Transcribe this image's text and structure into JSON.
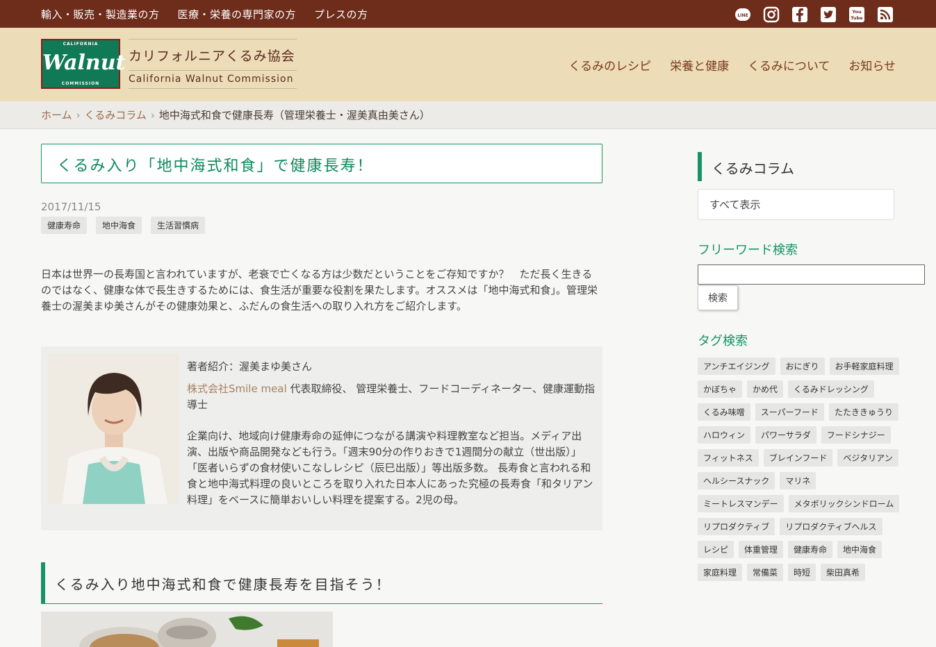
{
  "topbar": {
    "links": [
      "輸入・販売・製造業の方",
      "医療・栄養の専門家の方",
      "プレスの方"
    ],
    "social_icons": [
      "line-icon",
      "instagram-icon",
      "facebook-icon",
      "twitter-icon",
      "youtube-icon",
      "rss-icon"
    ]
  },
  "logo": {
    "top_text": "CALIFORNIA",
    "main_text": "Walnut",
    "bottom_text": "COMMISSION",
    "org_jp": "カリフォルニアくるみ協会",
    "org_en": "California Walnut Commission"
  },
  "nav": {
    "items": [
      "くるみのレシピ",
      "栄養と健康",
      "くるみについて",
      "お知らせ"
    ]
  },
  "breadcrumb": {
    "home": "ホーム",
    "column": "くるみコラム",
    "current": "地中海式和食で健康長寿（管理栄養士・渥美真由美さん）"
  },
  "article": {
    "title": "くるみ入り「地中海式和食」で健康長寿！",
    "date": "2017/11/15",
    "tags": [
      "健康寿命",
      "地中海食",
      "生活習慣病"
    ],
    "intro": "日本は世界一の長寿国と言われていますが、老衰で亡くなる方は少数だということをご存知ですか？　ただ長く生きるのではなく、健康な体で長生きするためには、食生活が重要な役割を果たします。オススメは「地中海式和食」。管理栄養士の渥美まゆ美さんがその健康効果と、ふだんの食生活への取り入れ方をご紹介します。",
    "author": {
      "heading": "著者紹介：渥美まゆ美さん",
      "company": "株式会社Smile meal",
      "roles": "代表取締役、 管理栄養士、フードコーディネーター、健康運動指導士",
      "bio": "企業向け、地域向け健康寿命の延伸につながる講演や料理教室など担当。メディア出演、出版や商品開発なども行う。「週末90分の作りおきで1週間分の献立（世出版）」「医者いらずの食材使いこなしレシピ（辰巳出版）」等出版多数。 長寿食と言われる和食と地中海式料理の良いところを取り入れた日本人にあった究極の長寿食「和タリアン料理」をベースに簡単おいしい料理を提案する。2児の母。"
    },
    "section_title": "くるみ入り地中海式和食で健康長寿を目指そう！"
  },
  "sidebar": {
    "column_heading": "くるみコラム",
    "show_all": "すべて表示",
    "freeword_heading": "フリーワード検索",
    "search_value": "",
    "search_button": "検索",
    "tag_heading": "タグ検索",
    "tags": [
      "アンチエイジング",
      "おにぎり",
      "お手軽家庭料理",
      "かぼちゃ",
      "かめ代",
      "くるみドレッシング",
      "くるみ味噌",
      "スーパーフード",
      "たたききゅうり",
      "ハロウィン",
      "パワーサラダ",
      "フードシナジー",
      "フィットネス",
      "ブレインフード",
      "ベジタリアン",
      "ヘルシースナック",
      "マリネ",
      "ミートレスマンデー",
      "メタボリックシンドローム",
      "リプロダクティブ",
      "リプロダクティブヘルス",
      "レシピ",
      "体重管理",
      "健康寿命",
      "地中海食",
      "家庭料理",
      "常備菜",
      "時短",
      "柴田真希"
    ]
  },
  "colors": {
    "topbar": "#6e2c1a",
    "header_bg": "#ecdcb8",
    "accent_green": "#199266",
    "link_brown": "#9a6b45"
  }
}
